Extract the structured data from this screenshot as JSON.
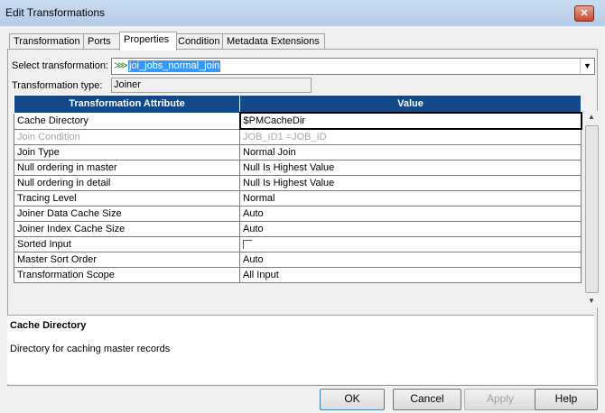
{
  "window": {
    "title": "Edit Transformations",
    "close_glyph": "✕"
  },
  "tabs": [
    "Transformation",
    "Ports",
    "Properties",
    "Condition",
    "Metadata Extensions"
  ],
  "active_tab": "Properties",
  "select_transformation": {
    "label": "Select transformation:",
    "value": "joi_jobs_normal_join",
    "arrow": "▼",
    "icon": "join-transform-icon"
  },
  "transformation_type": {
    "label": "Transformation type:",
    "value": "Joiner"
  },
  "grid": {
    "headers": [
      "Transformation Attribute",
      "Value"
    ],
    "rows": [
      {
        "attr": "Cache Directory",
        "value": "$PMCacheDir",
        "disabled": false
      },
      {
        "attr": "Join Condition",
        "value": "JOB_ID1 =JOB_ID",
        "disabled": true
      },
      {
        "attr": "Join Type",
        "value": "Normal Join",
        "disabled": false
      },
      {
        "attr": "Null ordering in master",
        "value": "Null Is Highest Value",
        "disabled": false
      },
      {
        "attr": "Null ordering in detail",
        "value": "Null Is Highest Value",
        "disabled": false
      },
      {
        "attr": "Tracing Level",
        "value": "Normal",
        "disabled": false
      },
      {
        "attr": "Joiner Data Cache Size",
        "value": "Auto",
        "disabled": false
      },
      {
        "attr": "Joiner Index Cache Size",
        "value": "Auto",
        "disabled": false
      },
      {
        "attr": "Sorted Input",
        "value": "",
        "checkbox": true,
        "checked": false,
        "disabled": false
      },
      {
        "attr": "Master Sort Order",
        "value": "Auto",
        "disabled": false
      },
      {
        "attr": "Transformation Scope",
        "value": "All Input",
        "disabled": false
      }
    ]
  },
  "description": {
    "heading": "Cache Directory",
    "text": "Directory for caching master records"
  },
  "buttons": {
    "ok": "OK",
    "cancel": "Cancel",
    "apply": "Apply",
    "help": "Help"
  },
  "colors": {
    "header_bg": "#13498a",
    "selection": "#3399ff",
    "titlebar": "#c9dcf1"
  }
}
